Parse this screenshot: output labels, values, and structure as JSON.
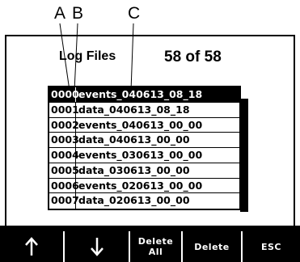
{
  "callouts": {
    "a": "A",
    "b": "B",
    "c": "C"
  },
  "header": {
    "title": "Log Files",
    "count": "58 of 58"
  },
  "files": [
    {
      "num": "0000",
      "name": "events_040613_08_18",
      "selected": true
    },
    {
      "num": "0001",
      "name": "data_040613_08_18"
    },
    {
      "num": "0002",
      "name": "events_040613_00_00"
    },
    {
      "num": "0003",
      "name": "data_040613_00_00"
    },
    {
      "num": "0004",
      "name": "events_030613_00_00"
    },
    {
      "num": "0005",
      "name": "data_030613_00_00"
    },
    {
      "num": "0006",
      "name": "events_020613_00_00"
    },
    {
      "num": "0007",
      "name": "data_020613_00_00"
    }
  ],
  "softkeys": {
    "up_icon": "arrow-up-icon",
    "down_icon": "arrow-down-icon",
    "delete_all": "Delete All",
    "delete": "Delete",
    "esc": "ESC"
  }
}
